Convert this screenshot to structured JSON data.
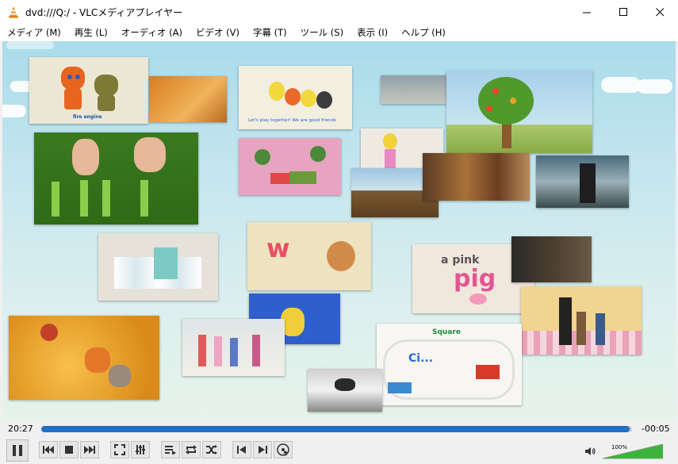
{
  "window": {
    "title": "dvd:///Q:/ - VLCメディアプレイヤー",
    "controls": [
      "minimize",
      "maximize",
      "close"
    ]
  },
  "menu": [
    {
      "label": "メディア (M)",
      "name": "menu-media"
    },
    {
      "label": "再生 (L)",
      "name": "menu-playback"
    },
    {
      "label": "オーディオ (A)",
      "name": "menu-audio"
    },
    {
      "label": "ビデオ (V)",
      "name": "menu-video"
    },
    {
      "label": "字幕 (T)",
      "name": "menu-subtitle"
    },
    {
      "label": "ツール (S)",
      "name": "menu-tools"
    },
    {
      "label": "表示 (I)",
      "name": "menu-view"
    },
    {
      "label": "ヘルプ (H)",
      "name": "menu-help"
    }
  ],
  "video": {
    "captions": {
      "fire_engine": "fire engine",
      "lets_play": "Let's play together!  We are good friends",
      "letter_w": "w",
      "a_pink": "a pink",
      "pig": "pig",
      "square": "Square",
      "circle": "Ci..."
    }
  },
  "timeline": {
    "elapsed": "20:27",
    "remaining": "-00:05",
    "progress": 0.996
  },
  "playback_controls": [
    {
      "name": "pause-button",
      "icon": "pause-icon"
    },
    {
      "name": "previous-button",
      "icon": "skip-back-icon"
    },
    {
      "name": "stop-button",
      "icon": "stop-icon"
    },
    {
      "name": "next-button",
      "icon": "skip-forward-icon"
    },
    {
      "name": "fullscreen-button",
      "icon": "fullscreen-icon"
    },
    {
      "name": "extended-settings-button",
      "icon": "equalizer-icon"
    },
    {
      "name": "playlist-button",
      "icon": "playlist-icon"
    },
    {
      "name": "loop-button",
      "icon": "loop-icon"
    },
    {
      "name": "shuffle-button",
      "icon": "shuffle-icon"
    },
    {
      "name": "previous-chapter-button",
      "icon": "previous-chapter-icon"
    },
    {
      "name": "next-chapter-button",
      "icon": "next-chapter-icon"
    },
    {
      "name": "disc-menu-button",
      "icon": "disc-menu-icon"
    }
  ],
  "volume": {
    "label": "100%",
    "level": 1.0,
    "icon": "speaker-icon"
  },
  "colors": {
    "accent": "#1e72c8",
    "volume": "#3db33d",
    "vlc_orange": "#f28c1a"
  }
}
